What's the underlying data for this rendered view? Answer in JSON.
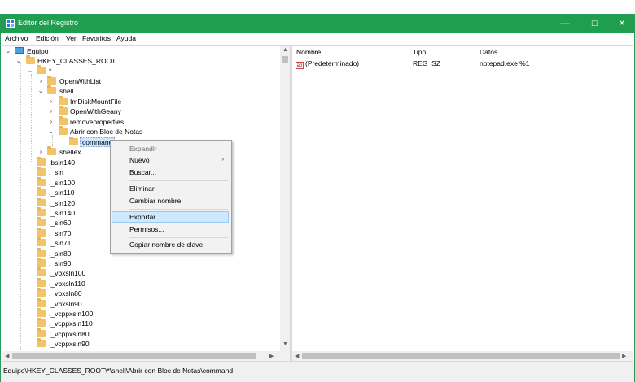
{
  "window": {
    "title": "Editor del Registro",
    "accent": "#1f9e4f",
    "controls": {
      "minimize": "—",
      "maximize": "☐",
      "close": "✕"
    }
  },
  "menu": [
    "Archivo",
    "Edición",
    "Ver",
    "Favoritos",
    "Ayuda"
  ],
  "tree": {
    "root": "Equipo",
    "hkcr": "HKEY_CLASSES_ROOT",
    "star": "*",
    "openwithlist": "OpenWithList",
    "shell": "shell",
    "shell_children": [
      "ImDiskMountFile",
      "OpenWithGeany",
      "removeproperties",
      "Abrir con Bloc de Notas"
    ],
    "command": "command",
    "shellex": "shellex",
    "keys": [
      ".bsln140",
      "._sln",
      "._sln100",
      "._sln110",
      "._sln120",
      "._sln140",
      "._sln60",
      "._sln70",
      "._sln71",
      "._sln80",
      "._sln90",
      "._vbxsln100",
      "._vbxsln110",
      "._vbxsln80",
      "._vbxsln90",
      "._vcppxsln100",
      "._vcppxsln110",
      "._vcppxsln80",
      "._vcppxsln90"
    ]
  },
  "values": {
    "headers": {
      "name": "Nombre",
      "type": "Tipo",
      "data": "Datos"
    },
    "rows": [
      {
        "icon": "ab",
        "name": "(Predeterminado)",
        "type": "REG_SZ",
        "data": "notepad.exe %1"
      }
    ]
  },
  "context_menu": {
    "items": [
      {
        "label": "Expandir",
        "disabled": true
      },
      {
        "label": "Nuevo",
        "submenu": true
      },
      {
        "label": "Buscar..."
      },
      {
        "sep": true
      },
      {
        "label": "Eliminar"
      },
      {
        "label": "Cambiar nombre"
      },
      {
        "sep": true
      },
      {
        "label": "Exportar",
        "hover": true
      },
      {
        "label": "Permisos..."
      },
      {
        "sep": true
      },
      {
        "label": "Copiar nombre de clave"
      }
    ]
  },
  "status": "Equipo\\HKEY_CLASSES_ROOT\\*\\shell\\Abrir con Bloc de Notas\\command"
}
